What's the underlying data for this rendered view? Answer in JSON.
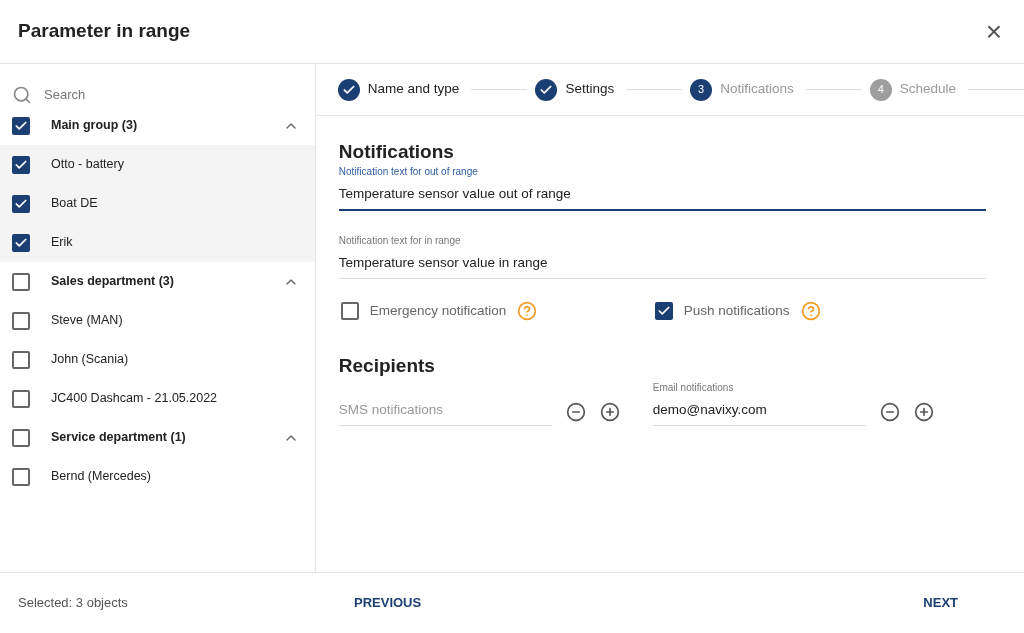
{
  "dialog": {
    "title": "Parameter in range",
    "close": "×"
  },
  "sidebar": {
    "search": {
      "placeholder": "Search"
    },
    "groups": [
      {
        "label": "Main group (3)",
        "checked": true,
        "expanded": true,
        "children": [
          {
            "label": "Otto - battery",
            "checked": true
          },
          {
            "label": "Boat DE",
            "checked": true
          },
          {
            "label": "Erik",
            "checked": true
          }
        ]
      },
      {
        "label": "Sales department (3)",
        "checked": false,
        "expanded": true,
        "children": [
          {
            "label": "Steve (MAN)",
            "checked": false
          },
          {
            "label": "John (Scania)",
            "checked": false
          },
          {
            "label": "JC400 Dashcam - 21.05.2022",
            "checked": false
          }
        ]
      },
      {
        "label": "Service department (1)",
        "checked": false,
        "expanded": true,
        "children": [
          {
            "label": "Bernd (Mercedes)",
            "checked": false
          }
        ]
      }
    ]
  },
  "steps": [
    {
      "label": "Name and type",
      "done": true
    },
    {
      "label": "Settings",
      "done": true
    },
    {
      "label": "Notifications",
      "number": "3",
      "done": false,
      "active": true
    },
    {
      "label": "Schedule",
      "number": "4",
      "done": false,
      "active": false
    }
  ],
  "notifications": {
    "title": "Notifications",
    "fields": [
      {
        "label": "Notification text for out of range",
        "value": "Temperature sensor value out of range",
        "focused": true
      },
      {
        "label": "Notification text for in range",
        "value": "Temperature sensor value in range",
        "focused": false
      }
    ],
    "options": [
      {
        "label": "Emergency notification",
        "checked": false
      },
      {
        "label": "Push notifications",
        "checked": true
      }
    ]
  },
  "recipients": {
    "title": "Recipients",
    "fields": [
      {
        "placeholder": "SMS notifications"
      },
      {
        "label": "Email notifications",
        "value": "demo@navixy.com"
      }
    ]
  },
  "footer": {
    "selected": "Selected: 3 objects",
    "previous": "PREVIOUS",
    "next": "NEXT"
  }
}
